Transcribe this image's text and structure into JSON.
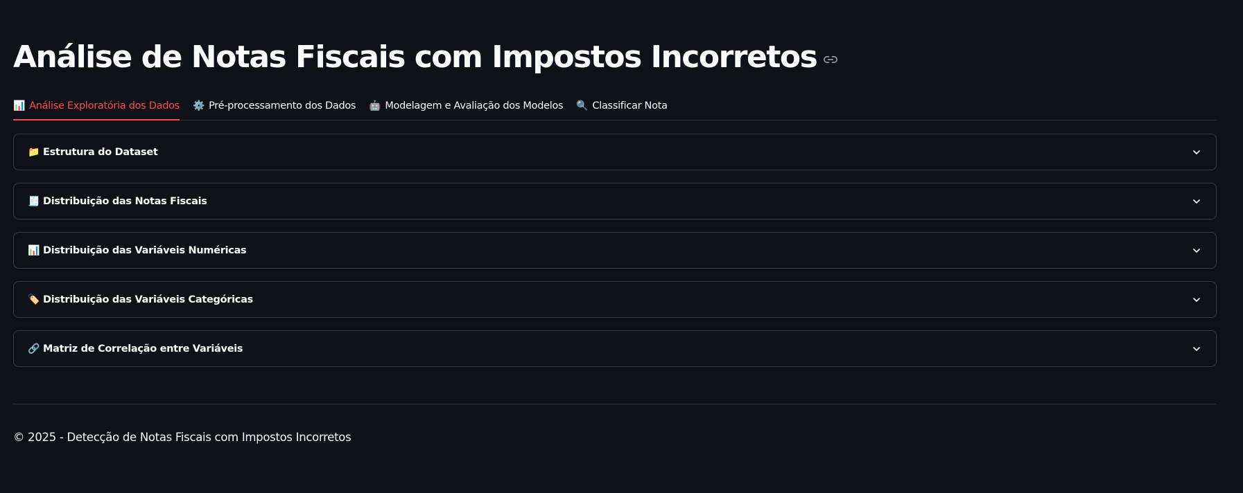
{
  "page": {
    "title": "Análise de Notas Fiscais com Impostos Incorretos",
    "title_anchor_icon": "link-icon"
  },
  "tabs": [
    {
      "emoji": "📊",
      "label": "Análise Exploratória dos Dados",
      "active": true
    },
    {
      "emoji": "⚙️",
      "label": "Pré-processamento dos Dados",
      "active": false
    },
    {
      "emoji": "🤖",
      "label": "Modelagem e Avaliação dos Modelos",
      "active": false
    },
    {
      "emoji": "🔍",
      "label": "Classificar Nota",
      "active": false
    }
  ],
  "expanders": [
    {
      "emoji": "📁",
      "label": "Estrutura do Dataset",
      "icon": "chevron-down-icon"
    },
    {
      "emoji": "🧾",
      "label": "Distribuição das Notas Fiscais",
      "icon": "chevron-down-icon"
    },
    {
      "emoji": "📊",
      "label": "Distribuição das Variáveis Numéricas",
      "icon": "chevron-down-icon"
    },
    {
      "emoji": "🏷️",
      "label": "Distribuição das Variáveis Categóricas",
      "icon": "chevron-down-icon"
    },
    {
      "emoji": "🔗",
      "label": "Matriz de Correlação entre Variáveis",
      "icon": "chevron-down-icon"
    }
  ],
  "footer": {
    "text": "© 2025 - Detecção de Notas Fiscais com Impostos Incorretos"
  },
  "colors": {
    "background": "#0e1117",
    "accent": "#ff4b4b",
    "text": "#fafafa",
    "border": "#3c3f4a"
  }
}
